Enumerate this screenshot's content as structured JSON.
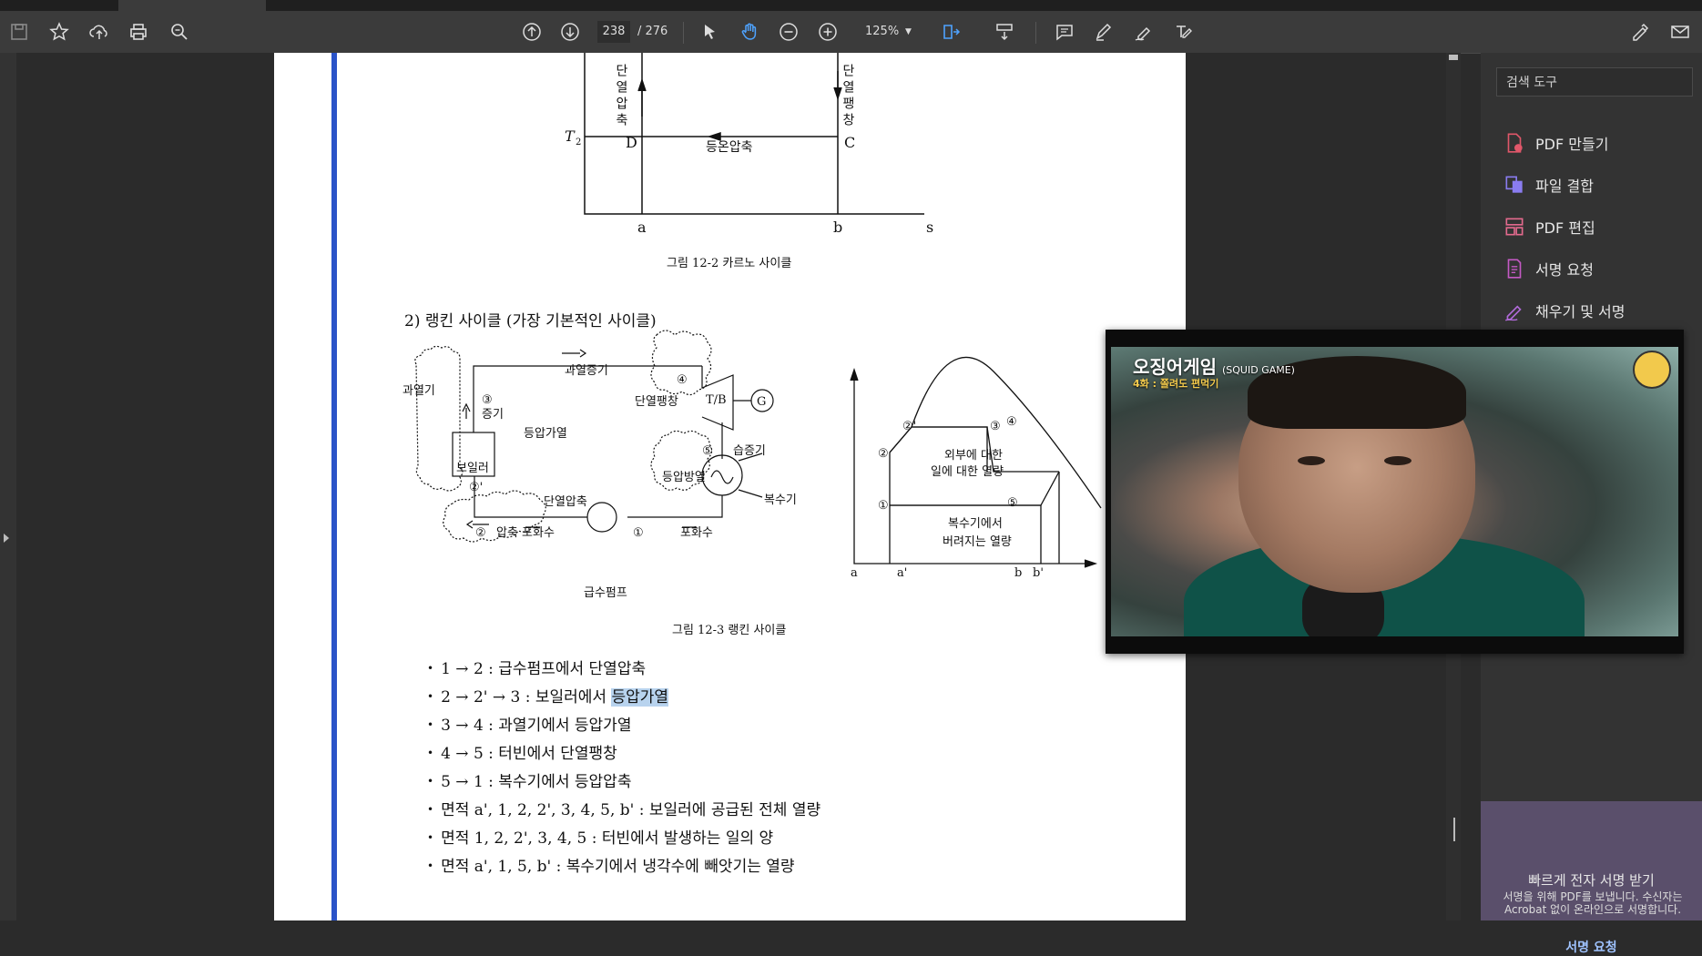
{
  "toolbar": {
    "page_current": "238",
    "page_total": "/ 276",
    "zoom": "125%"
  },
  "right_panel": {
    "search_placeholder": "검색 도구",
    "tools": [
      "PDF 만들기",
      "파일 결합",
      "PDF 편집",
      "서명 요청",
      "채우기 및 서명"
    ],
    "esign_title": "빠르게 전자 서명 받기",
    "esign_desc": "서명을 위해 PDF를 보냅니다. 수신자는 Acrobat 없이 온라인으로 서명합니다.",
    "esign_link": "서명 요청"
  },
  "video": {
    "title": "오징어게임",
    "title_en": "(SQUID GAME)",
    "subtitle": "4화 : 쫄려도 편먹기"
  },
  "document": {
    "carnot_labels": {
      "t2": "T",
      "t2_sub": "2",
      "left_vertical": "단열압축",
      "right_vertical": "단열팽창",
      "bottom_process": "등온압축",
      "d": "D",
      "c": "C",
      "a": "a",
      "b": "b",
      "s": "s"
    },
    "fig1_caption": "그림 12-2   카르노 사이클",
    "heading": "2) 랭킨 사이클 (가장 기본적인 사이클)",
    "rankine_diagram": {
      "superheater": "과열기",
      "superheat_steam": "과열증기",
      "steam": "증기",
      "const_p_heat": "등압가열",
      "boiler": "보일러",
      "adiabatic_exp": "단열팽창",
      "tb": "T/B",
      "g": "G",
      "wet_steam": "습증기",
      "const_p_cool": "등압방열",
      "condenser": "복수기",
      "adiabatic_comp": "단열압축",
      "compressed_water": "압축 포화수",
      "sat_water": "포화수",
      "feed_pump": "급수펌프",
      "n1": "①",
      "n2": "②",
      "n2p": "②'",
      "n3": "③",
      "n4": "④",
      "n5": "⑤"
    },
    "ts_diagram": {
      "work_label_1": "외부에 대한",
      "work_label_2": "일에 대한 열량",
      "cond_label_1": "복수기에서",
      "cond_label_2": "버려지는 열량",
      "a": "a",
      "ap": "a'",
      "b": "b",
      "bp": "b'"
    },
    "fig2_caption": "그림 12-3   랭킨 사이클",
    "bullets": [
      "1 → 2 : 급수펌프에서 단열압축",
      "2 → 2' → 3 : 보일러에서 ",
      "3 → 4 : 과열기에서 등압가열",
      "4 → 5 : 터빈에서 단열팽창",
      "5 → 1 : 복수기에서 등압압축",
      "면적 a', 1, 2, 2', 3, 4, 5, b' : 보일러에 공급된 전체 열량",
      "면적 1, 2, 2', 3, 4, 5 : 터빈에서 발생하는 일의 양",
      "면적 a', 1, 5, b' : 복수기에서 냉각수에 빼앗기는 열량"
    ],
    "bullet_highlight": "등압가열"
  }
}
